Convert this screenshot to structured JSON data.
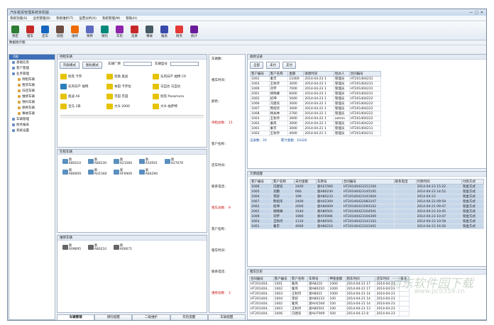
{
  "window": {
    "title": "汽车租赁管理系统单机版"
  },
  "menu": [
    "系统功能(S)",
    "业务管理(B)",
    "系统维护(T)",
    "运营分析(A)",
    "系统管理(M)",
    "帮助(H)"
  ],
  "toolbar": [
    {
      "label": "预定",
      "color": "#2e7d32"
    },
    {
      "label": "租车",
      "color": "#c62828"
    },
    {
      "label": "还车",
      "color": "#1565c0"
    },
    {
      "label": "续租",
      "color": "#6d4c41"
    },
    {
      "label": "维修",
      "color": "#ef6c00"
    },
    {
      "label": "保养",
      "color": "#5c6bc0"
    },
    {
      "label": "保险",
      "color": "#00897b"
    },
    {
      "label": "年检",
      "color": "#8e24aa"
    },
    {
      "label": "违章",
      "color": "#c62828"
    },
    {
      "label": "事故",
      "color": "#455a64"
    },
    {
      "label": "报表",
      "color": "#3949ab"
    },
    {
      "label": "财务",
      "color": "#e53935"
    },
    {
      "label": "统计",
      "color": "#6a1b9a"
    }
  ],
  "subtool": "数据统计图",
  "tree": {
    "tab": "功能",
    "nodes": [
      {
        "label": "基础信息",
        "sub": false
      },
      {
        "label": "客户管理",
        "sub": false
      },
      {
        "label": "业务管理",
        "sub": false
      },
      {
        "label": "待租车辆",
        "sub": true
      },
      {
        "label": "租赁车辆",
        "sub": true
      },
      {
        "label": "归还车辆",
        "sub": true
      },
      {
        "label": "维修车辆",
        "sub": true
      },
      {
        "label": "预约车辆",
        "sub": true
      },
      {
        "label": "保养车辆",
        "sub": true
      },
      {
        "label": "事故车辆",
        "sub": true
      },
      {
        "label": "车辆管理",
        "sub": false
      },
      {
        "label": "财务报表",
        "sub": false
      },
      {
        "label": "系统设置",
        "sub": false
      }
    ]
  },
  "available": {
    "title": "待租车辆",
    "btn_list": "列表模式",
    "btn_icon": "图标模式",
    "brand_label": "车辆厂牌",
    "model_label": "车辆型号",
    "cars": [
      {
        "label": "别克 卡罗",
        "color": "#e6c300"
      },
      {
        "label": "奔驰 奥迪",
        "color": "#e6c300"
      },
      {
        "label": "东风日产 福特 CR",
        "color": "#e6c300"
      },
      {
        "label": "东风日产 福特",
        "color": "#2c7fb8"
      },
      {
        "label": "本田 卡罗拉",
        "color": "#e6c300"
      },
      {
        "label": "马自达 马自达",
        "color": "#e6c300"
      },
      {
        "label": "奥迪 A6",
        "color": "#e6c300"
      },
      {
        "label": "丰田 丰田",
        "color": "#e6c300"
      },
      {
        "label": "别克 Panamera",
        "color": "#e6c300"
      },
      {
        "label": "宝马 3系",
        "color": "#e6c300"
      },
      {
        "label": "大众 2000",
        "color": "#e6c300"
      },
      {
        "label": "大众 帕萨特",
        "color": "#e6c300"
      }
    ]
  },
  "rented": {
    "title": "在租车辆",
    "cars": [
      "浙A80210",
      "浙A80230",
      "浙A21560",
      "浙A50501",
      "浙A27076",
      "浙A80009",
      "浙AH1560",
      "浙AF6909",
      "浙A84290"
    ]
  },
  "returned": {
    "title": "维修车辆",
    "cars": [
      "浙A09695",
      "浙A80210",
      "浙A00071"
    ]
  },
  "info": {
    "sections": [
      {
        "label": "车辆数：",
        "value": "",
        "red": false
      },
      {
        "label": "租车时间：",
        "value": "",
        "red": false
      },
      {
        "label": "颜色：",
        "value": "",
        "red": false
      },
      {
        "label": "待租总数：",
        "value": "15",
        "red": true
      },
      {
        "label": "客户名称：",
        "value": "",
        "red": false
      },
      {
        "label": "还车时间：",
        "value": "",
        "red": false
      },
      {
        "label": "联系电话：",
        "value": "",
        "red": false
      },
      {
        "label": "租车总数：",
        "value": "9",
        "red": true
      },
      {
        "label": "客户名称：",
        "value": "",
        "red": false
      },
      {
        "label": "租车时间：",
        "value": "",
        "red": false
      },
      {
        "label": "联系电话：",
        "value": "",
        "red": false
      },
      {
        "label": "维修总数：",
        "value": "3",
        "red": true
      }
    ]
  },
  "bottom_tabs": [
    "车辆管理",
    "保险提醒",
    "二级维护",
    "年检提醒",
    "车辆提醒"
  ],
  "orders": {
    "title": "收款记录",
    "btns": [
      "全部",
      "未付",
      "支付"
    ],
    "headers": [
      "客户编号",
      "客户名称",
      "金额",
      "收款时间",
      "经办人",
      "合同编号"
    ],
    "rows": [
      [
        "1001",
        "秦丰",
        "11000",
        "2014-04-23 1",
        "管理员",
        "HT201404231"
      ],
      [
        "1003",
        "王秋玲",
        "3000",
        "2014-04-23 1",
        "管理员",
        "HT201404231"
      ],
      [
        "1009",
        "刘宇",
        "7000",
        "2014-04-23 1",
        "管理员",
        "HT201404231"
      ],
      [
        "2001",
        "杨晓峰",
        "6000",
        "2014-04-23 1",
        "管理员",
        "HT201404231"
      ],
      [
        "2002",
        "纪坤",
        "5000",
        "2014-04-23 1",
        "管理员",
        "HT201404222"
      ],
      [
        "1006",
        "冯建农",
        "3000",
        "2014-04-22 1",
        "管理员",
        "HT201404222"
      ],
      [
        "1007",
        "熊绍华",
        "3000",
        "2014-04-22 1",
        "管理员",
        "HT201404222"
      ],
      [
        "1008",
        "杨永林",
        "2760",
        "2014-04-22 1",
        "管理员",
        "HT201404222"
      ],
      [
        "1003",
        "王秋玲",
        "3000",
        "2014-04-22 1",
        "admin",
        "HT201404222"
      ],
      [
        "1002",
        "秦风",
        "3000",
        "2014-04-22 1",
        "管理员",
        "HT201404222"
      ],
      [
        "1001",
        "秦丰",
        "3000",
        "2014-04-21 1",
        "管理员",
        "HT201404211"
      ],
      [
        "1003",
        "王秋玲",
        "4000",
        "2014-04-21 1",
        "管理员",
        "HT201404211"
      ]
    ],
    "summary_a": "记录数：20",
    "summary_b": "累计金额：10320"
  },
  "reminders": {
    "title": "欠费提醒",
    "headers": [
      "客户编号",
      "客户名称",
      "未付金额",
      "车牌号",
      "合同编号",
      "联系电话",
      "付款时间",
      "付款方式"
    ],
    "rows": [
      [
        "1006",
        "冯建农",
        "2400",
        "浙A21560",
        "HT20140423151104",
        "",
        "2014-04-23 15:22",
        "现金方式"
      ],
      [
        "1005",
        "刘鹏",
        "660",
        "浙A80230",
        "HT20140423145105",
        "",
        "2014-04-23 14:52",
        "现金方式"
      ],
      [
        "1004",
        "李舒",
        "199",
        "浙A80233",
        "HT20140423141604",
        "",
        "2014-04-23",
        "现金方式"
      ],
      [
        "1007",
        "熊绍华",
        "2400",
        "浙A42300",
        "HT20140422083107",
        "",
        "2014-04-22 09:59",
        "现金方式"
      ],
      [
        "2002",
        "纪坤",
        "2000",
        "浙A80009",
        "HT20140421093102",
        "",
        "2014-04-21 09:47",
        "现金方式"
      ],
      [
        "2001",
        "杨晓峰",
        "3140",
        "浙A80501",
        "HT20140423104501",
        "",
        "2014-04-23 10:45",
        "现金方式"
      ],
      [
        "1009",
        "刘宇",
        "1900",
        "浙AF6906",
        "HT20140423104309",
        "",
        "2014-04-23 10:47",
        "现金方式"
      ],
      [
        "1003",
        "王秋玲",
        "1110",
        "浙A80501",
        "HT20140423141103",
        "",
        "2014-04-23 10:58",
        "现金方式"
      ],
      [
        "1001",
        "秦丰",
        "4000",
        "浙A80216",
        "HT20140423101001",
        "",
        "2014-04-23 16:26",
        "现金方式"
      ]
    ]
  },
  "history": {
    "title": "租车历史",
    "headers": [
      "合同编号",
      "客户编号",
      "客户名称",
      "车牌号",
      "押金金额",
      "租车时间",
      "还车时间",
      "备注"
    ],
    "rows": [
      [
        "HT201404..",
        "1001",
        "秦风",
        "浙A8210",
        "1000",
        "2014-04-21 17",
        "2014-04-23",
        ""
      ],
      [
        "HT201404..",
        "1002",
        "秦风",
        "浙A80210",
        "1000",
        "2014-04-21 17",
        "2014-04-23",
        ""
      ],
      [
        "HT201404..",
        "1003",
        "王秋玲",
        "浙A8021",
        "1000",
        "2014-04-21 14",
        "2014-04-23",
        ""
      ],
      [
        "HT201404..",
        "1004",
        "李舒",
        "浙A80233",
        "100",
        "2014-04-21 14",
        "2014-04-23",
        ""
      ],
      [
        "HT201404..",
        "1002",
        "秦风",
        "浙AH1560",
        "100",
        "2014-04-21 14",
        "2014-04-23",
        ""
      ],
      [
        "HT201404..",
        "1003",
        "王秋玲",
        "浙A80501",
        "100",
        "2014-04-21 13",
        "2014-04-23",
        ""
      ],
      [
        "HT201404..",
        "1006",
        "冯建农",
        "浙AH7909",
        "500",
        "2014-04-13 8",
        "2014-04-23",
        ""
      ]
    ]
  },
  "watermark": {
    "line1": "河东软件园下载",
    "line2": "www.pc0359.cn"
  }
}
